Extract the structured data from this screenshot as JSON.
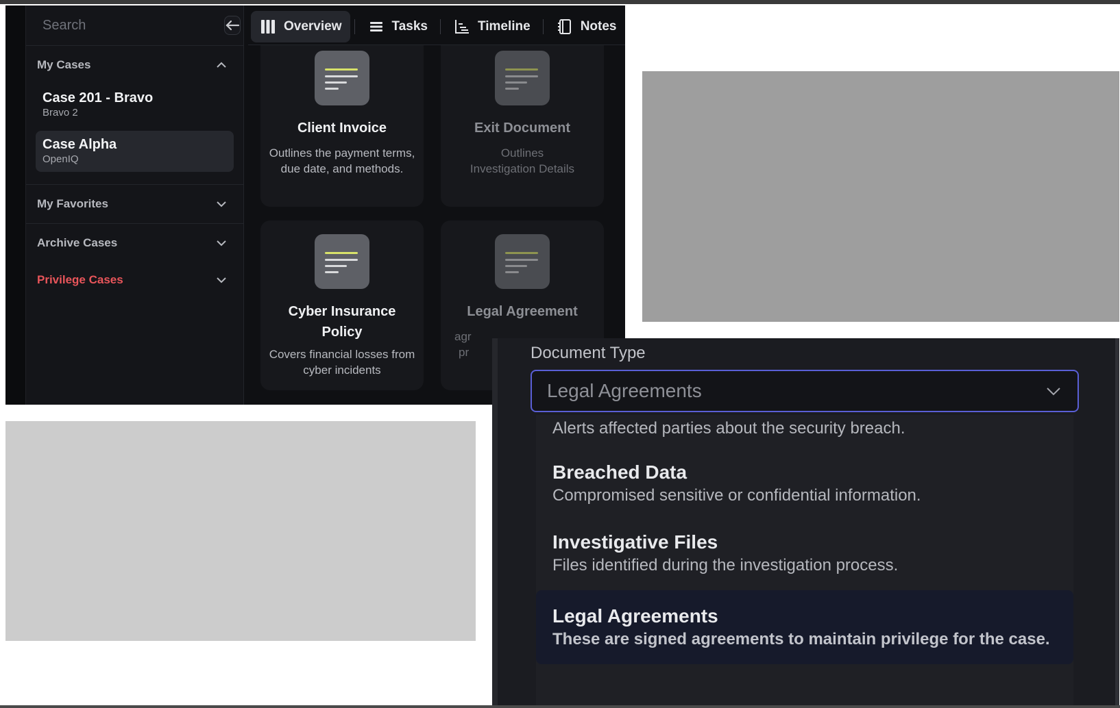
{
  "search": {
    "placeholder": "Search"
  },
  "sidebar": {
    "sections": [
      {
        "label": "My Cases",
        "expanded": true
      },
      {
        "label": "My Favorites",
        "expanded": false
      },
      {
        "label": "Archive Cases",
        "expanded": false
      },
      {
        "label": "Privilege Cases",
        "expanded": false,
        "color": "#e8555a"
      }
    ],
    "cases": [
      {
        "title": "Case 201 - Bravo",
        "subtitle": "Bravo 2",
        "active": false
      },
      {
        "title": "Case Alpha",
        "subtitle": "OpenIQ",
        "active": true
      }
    ]
  },
  "tabs": [
    {
      "label": "Overview",
      "icon": "columns-icon",
      "active": true
    },
    {
      "label": "Tasks",
      "icon": "list-icon",
      "active": false
    },
    {
      "label": "Timeline",
      "icon": "timeline-icon",
      "active": false
    },
    {
      "label": "Notes",
      "icon": "notebook-icon",
      "active": false
    }
  ],
  "cards": [
    {
      "title": "Client Invoice",
      "description": "Outlines the payment terms, due date, and methods.",
      "enabled": true
    },
    {
      "title": "Exit Document",
      "description": "Outlines Investigation Details",
      "enabled": false
    },
    {
      "title": "Cyber Insurance Policy",
      "description": "Covers financial losses from cyber incidents",
      "enabled": true
    },
    {
      "title": "Legal Agreement",
      "description": "agr",
      "description_line2": "pr",
      "enabled": false
    }
  ],
  "document_type": {
    "label": "Document Type",
    "selected_value": "Legal Agreements",
    "options": [
      {
        "title": "",
        "description": "Alerts affected parties about the security breach."
      },
      {
        "title": "Breached Data",
        "description": "Compromised sensitive or confidential information."
      },
      {
        "title": "Investigative Files",
        "description": "Files identified during the investigation process."
      },
      {
        "title": "Legal Agreements",
        "description": "These are signed agreements to maintain privilege for the case.",
        "selected": true
      }
    ]
  },
  "colors": {
    "accent": "#5a5fd6",
    "danger": "#e8555a",
    "doc_line_highlight": "#d8e26a"
  }
}
